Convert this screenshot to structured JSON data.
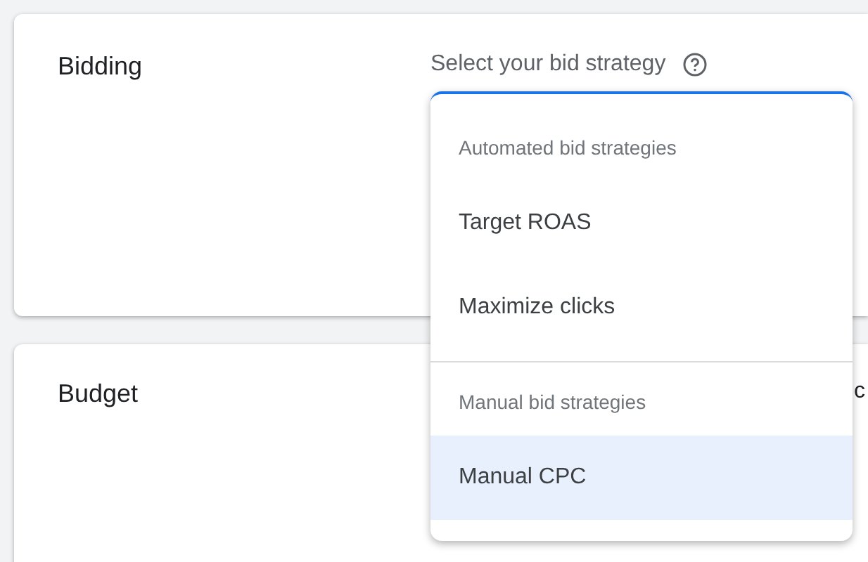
{
  "sections": [
    {
      "title": "Bidding",
      "field_label": "Select your bid strategy"
    },
    {
      "title": "Budget",
      "cut_text": "c"
    }
  ],
  "dropdown": {
    "groups": [
      {
        "header": "Automated bid strategies",
        "options": [
          {
            "label": "Target ROAS",
            "selected": false
          },
          {
            "label": "Maximize clicks",
            "selected": false
          }
        ]
      },
      {
        "header": "Manual bid strategies",
        "options": [
          {
            "label": "Manual CPC",
            "selected": true
          }
        ]
      }
    ]
  }
}
